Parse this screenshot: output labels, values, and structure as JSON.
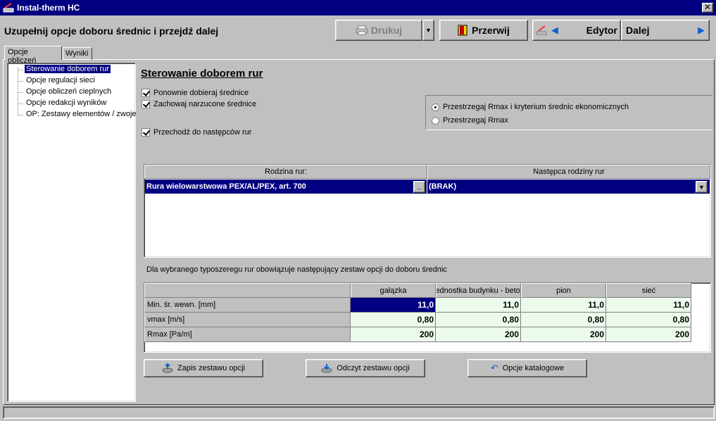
{
  "window": {
    "title": "Instal-therm HC"
  },
  "header": {
    "title": "Uzupełnij opcje doboru średnic i przejdź dalej",
    "print_label": "Drukuj",
    "abort_label": "Przerwij",
    "editor_label": "Edytor",
    "next_label": "Dalej"
  },
  "tabs": [
    {
      "label": "Opcje obliczeń"
    },
    {
      "label": "Wyniki"
    }
  ],
  "tree": {
    "items": [
      {
        "label": "Sterowanie doborem rur",
        "selected": true
      },
      {
        "label": "Opcje regulacji sieci"
      },
      {
        "label": "Opcje obliczeń cieplnych"
      },
      {
        "label": "Opcje redakcji wyników"
      },
      {
        "label": "OP: Zestawy elementów / zwoje"
      }
    ]
  },
  "panel": {
    "title": "Sterowanie doborem rur",
    "checkboxes": [
      {
        "label": "Ponownie dobieraj średnice",
        "checked": true
      },
      {
        "label": "Zachowaj narzucone średnice",
        "checked": true
      },
      {
        "label": "Przechodź do następców rur",
        "checked": true
      }
    ],
    "radios": [
      {
        "label": "Przestrzegaj Rmax i kryterium średnic ekonomicznych",
        "selected": true
      },
      {
        "label": "Przestrzegaj Rmax",
        "selected": false
      }
    ],
    "family_grid": {
      "headers": [
        "Rodzina rur:",
        "Następca rodziny rur"
      ],
      "row": {
        "family": "Rura wielowarstwowa PEX/AL/PEX, art. 700",
        "successor": "(BRAK)",
        "ellipsis": "..."
      }
    },
    "info_text": "Dla wybranego typoszeregu rur obowiązuje następujący zestaw opcji do doboru średnic",
    "options_grid": {
      "columns": [
        "gałązka",
        "jednostka budynku - beto",
        "pion",
        "sieć"
      ],
      "rows": [
        {
          "label": "Min. śr. wewn. [mm]",
          "values": [
            "11,0",
            "11,0",
            "11,0",
            "11,0"
          ]
        },
        {
          "label": "vmax [m/s]",
          "values": [
            "0,80",
            "0,80",
            "0,80",
            "0,80"
          ]
        },
        {
          "label": "Rmax [Pa/m]",
          "values": [
            "200",
            "200",
            "200",
            "200"
          ]
        }
      ]
    },
    "buttons": {
      "save": "Zapis zestawu opcji",
      "load": "Odczyt zestawu opcji",
      "catalog": "Opcje katalogowe"
    }
  },
  "colors": {
    "titlebar": "#000080",
    "selection": "#000080",
    "cell_bg": "#ecfaec",
    "face": "#c0c0c0"
  }
}
